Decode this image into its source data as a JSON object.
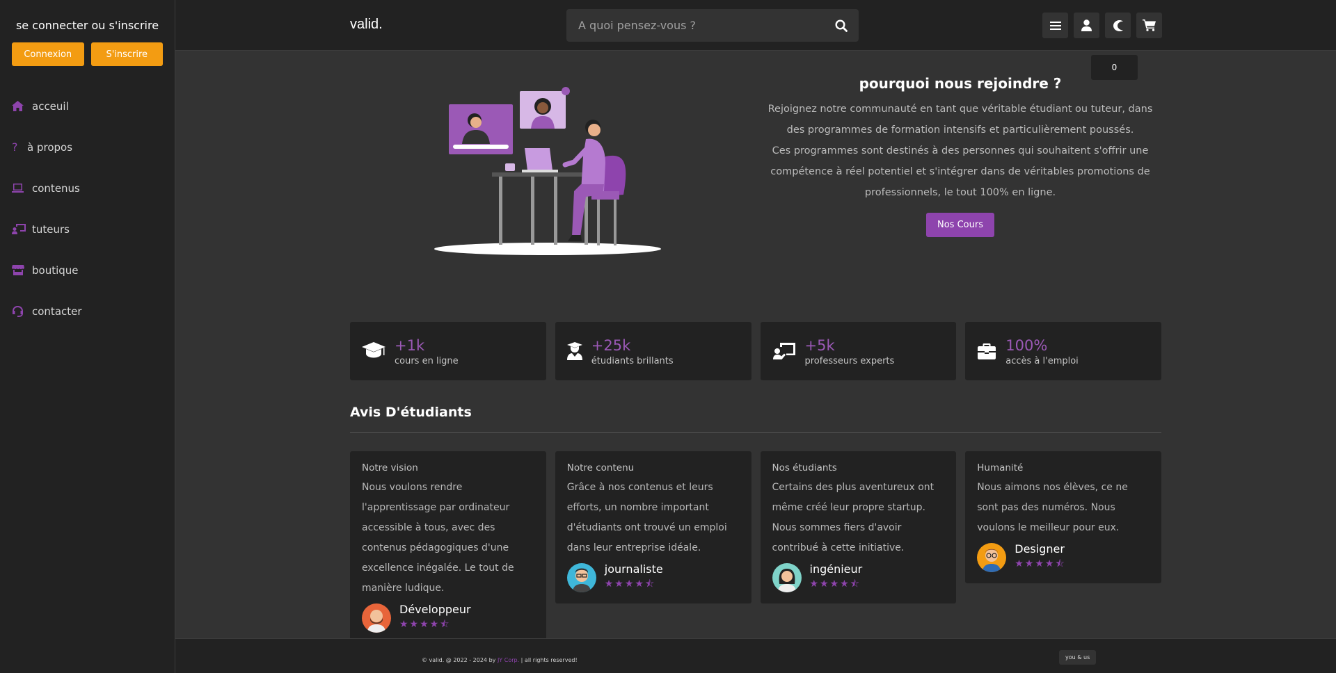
{
  "sidebar": {
    "title": "se connecter ou s'inscrire",
    "login_label": "Connexion",
    "register_label": "S'inscrire",
    "items": [
      {
        "label": "acceuil",
        "icon": "home-icon"
      },
      {
        "label": "à propos",
        "icon": "question-icon"
      },
      {
        "label": "contenus",
        "icon": "laptop-icon"
      },
      {
        "label": "tuteurs",
        "icon": "chalkboard-teacher-icon"
      },
      {
        "label": "boutique",
        "icon": "store-icon"
      },
      {
        "label": "contacter",
        "icon": "headset-icon"
      }
    ]
  },
  "header": {
    "logo": "valid.",
    "search_placeholder": "A quoi pensez-vous ?",
    "cart_count": "0"
  },
  "hero": {
    "title": "pourquoi nous rejoindre ?",
    "paragraph1": "Rejoignez notre communauté en tant que véritable étudiant ou tuteur, dans des programmes de formation intensifs et particulièrement poussés.",
    "paragraph2": "Ces programmes sont destinés à des personnes qui souhaitent s'offrir une compétence à réel potentiel et s'intégrer dans de véritables promotions de professionnels, le tout 100% en ligne.",
    "button": "Nos Cours"
  },
  "stats": [
    {
      "value": "+1k",
      "label": "cours en ligne",
      "icon": "graduation-cap-icon"
    },
    {
      "value": "+25k",
      "label": "étudiants brillants",
      "icon": "user-graduate-icon"
    },
    {
      "value": "+5k",
      "label": "professeurs experts",
      "icon": "chalkboard-teacher-icon"
    },
    {
      "value": "100%",
      "label": "accès à l'emploi",
      "icon": "briefcase-icon"
    }
  ],
  "reviews_title": "Avis D'étudiants",
  "reviews": [
    {
      "heading": "Notre vision",
      "text": "Nous voulons rendre l'apprentissage par ordinateur accessible à tous, avec des contenus pédagogiques d'une excellence inégalée. Le tout de manière ludique.",
      "name": "Développeur",
      "stars": "★★★★⯪",
      "avatar_color": "#e8653a"
    },
    {
      "heading": "Notre contenu",
      "text": "Grâce à nos contenus et leurs efforts, un nombre important d'étudiants ont trouvé un emploi dans leur entreprise idéale.",
      "name": "journaliste",
      "stars": "★★★★⯪",
      "avatar_color": "#3fb7d9"
    },
    {
      "heading": "Nos étudiants",
      "text": "Certains des plus aventureux ont même créé leur propre startup. Nous sommes fiers d'avoir contribué à cette initiative.",
      "name": "ingénieur",
      "stars": "★★★★⯪",
      "avatar_color": "#7fd3c9"
    },
    {
      "heading": "Humanité",
      "text": "Nous aimons nos élèves, ce ne sont pas des numéros. Nous voulons le meilleur pour eux.",
      "name": "Designer",
      "stars": "★★★★⯪",
      "avatar_color": "#f39c12"
    }
  ],
  "footer": {
    "copy_prefix": "© valid. @ 2022 - 2024 by",
    "corp": "JY Corp.",
    "copy_suffix": "| all rights reserved!",
    "badge": "you & us"
  },
  "colors": {
    "accent": "#8e44ad",
    "orange": "#f39c12",
    "panel": "#222222",
    "background": "#333333"
  }
}
